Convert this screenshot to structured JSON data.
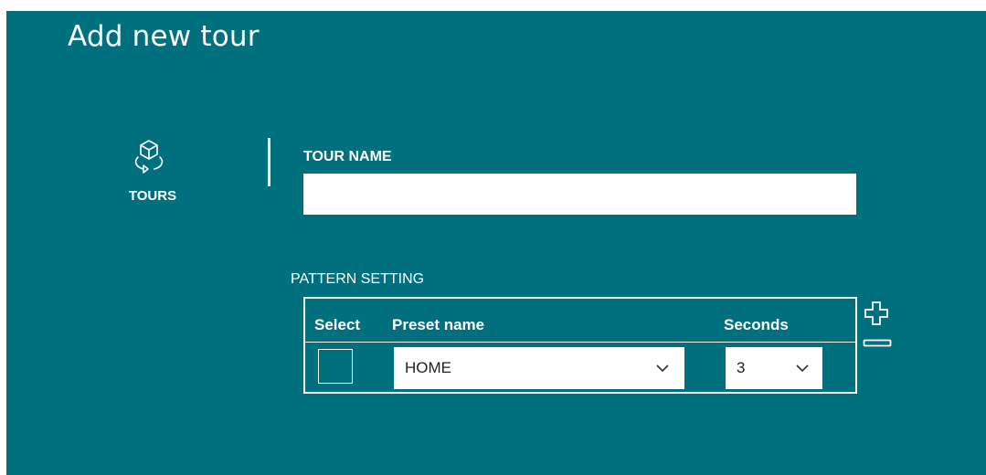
{
  "page": {
    "title": "Add new tour"
  },
  "side_nav": {
    "icon": "tour-cube-icon",
    "label": "TOURS"
  },
  "form": {
    "tour_name_label": "TOUR NAME",
    "tour_name_value": "",
    "pattern_label": "PATTERN SETTING"
  },
  "pattern_table": {
    "columns": [
      "Select",
      "Preset name",
      "Seconds"
    ],
    "rows": [
      {
        "checked": false,
        "preset": "HOME",
        "seconds": "3"
      }
    ]
  },
  "actions": {
    "add_icon": "plus-icon",
    "remove_icon": "minus-icon"
  },
  "colors": {
    "background": "#00707f",
    "foreground": "#ffffff"
  }
}
